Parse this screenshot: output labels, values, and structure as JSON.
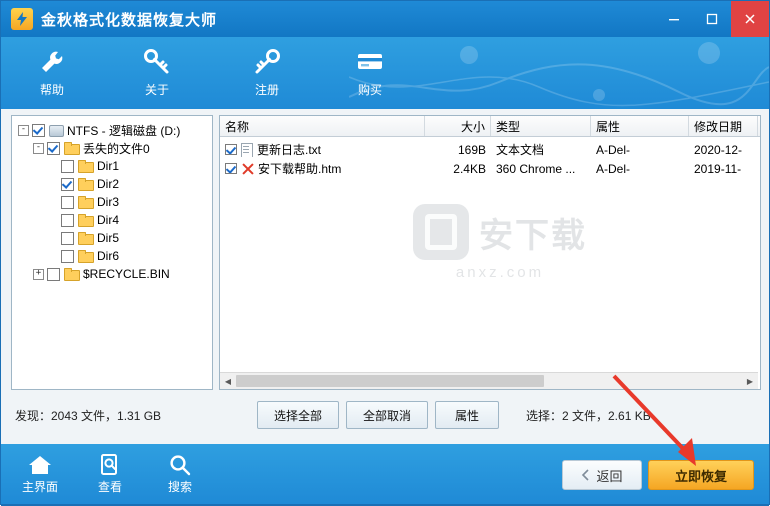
{
  "window": {
    "title": "金秋格式化数据恢复大师",
    "logo_glyph": "⚡",
    "minimize": "—",
    "maximize": "□",
    "close": "✕"
  },
  "toolbar": {
    "items": [
      {
        "label": "帮助",
        "icon": "wrench-icon"
      },
      {
        "label": "关于",
        "icon": "key-icon"
      },
      {
        "label": "注册",
        "icon": "key-icon"
      },
      {
        "label": "购买",
        "icon": "card-icon"
      }
    ]
  },
  "tree": {
    "nodes": [
      {
        "label": "NTFS - 逻辑磁盘 (D:)",
        "indent": 0,
        "expander": "-",
        "checked": true,
        "icon": "disk-icon"
      },
      {
        "label": "丢失的文件0",
        "indent": 1,
        "expander": "-",
        "checked": true,
        "icon": "folder-icon"
      },
      {
        "label": "Dir1",
        "indent": 2,
        "expander": "",
        "checked": false,
        "icon": "folder-icon"
      },
      {
        "label": "Dir2",
        "indent": 2,
        "expander": "",
        "checked": true,
        "icon": "folder-icon"
      },
      {
        "label": "Dir3",
        "indent": 2,
        "expander": "",
        "checked": false,
        "icon": "folder-icon"
      },
      {
        "label": "Dir4",
        "indent": 2,
        "expander": "",
        "checked": false,
        "icon": "folder-icon"
      },
      {
        "label": "Dir5",
        "indent": 2,
        "expander": "",
        "checked": false,
        "icon": "folder-icon"
      },
      {
        "label": "Dir6",
        "indent": 2,
        "expander": "",
        "checked": false,
        "icon": "folder-icon"
      },
      {
        "label": "$RECYCLE.BIN",
        "indent": 1,
        "expander": "+",
        "checked": false,
        "icon": "folder-icon"
      }
    ]
  },
  "filelist": {
    "columns": [
      "名称",
      "大小",
      "类型",
      "属性",
      "修改日期"
    ],
    "rows": [
      {
        "checked": true,
        "icon": "text-file-icon",
        "name": "更新日志.txt",
        "size": "169B",
        "type": "文本文档",
        "attr": "A-Del-",
        "date": "2020-12-"
      },
      {
        "checked": true,
        "icon": "deleted-file-icon",
        "name": "安下载帮助.htm",
        "size": "2.4KB",
        "type": "360 Chrome ...",
        "attr": "A-Del-",
        "date": "2019-11-"
      }
    ],
    "watermark": {
      "title": "安下载",
      "sub": "anxz.com"
    },
    "scroll_left_arrow": "◀",
    "scroll_right_arrow": "▶"
  },
  "status": {
    "found": "发现：2043 文件，1.31 GB",
    "selection": "选择：2 文件，2.61 KB",
    "buttons": [
      {
        "label": "选择全部"
      },
      {
        "label": "全部取消"
      },
      {
        "label": "属性"
      }
    ]
  },
  "footer": {
    "items": [
      {
        "label": "主界面",
        "icon": "home-icon"
      },
      {
        "label": "查看",
        "icon": "document-search-icon"
      },
      {
        "label": "搜索",
        "icon": "magnifier-icon"
      }
    ],
    "back_label": "返回",
    "back_icon": "chevron-left-icon",
    "recover_label": "立即恢复"
  },
  "colors": {
    "accent": "#1f8ad6",
    "header_gradient_top": "#2f9fe0",
    "recover_button": "#f5a623",
    "close_button": "#e04343",
    "arrow_red": "#e8392b"
  }
}
